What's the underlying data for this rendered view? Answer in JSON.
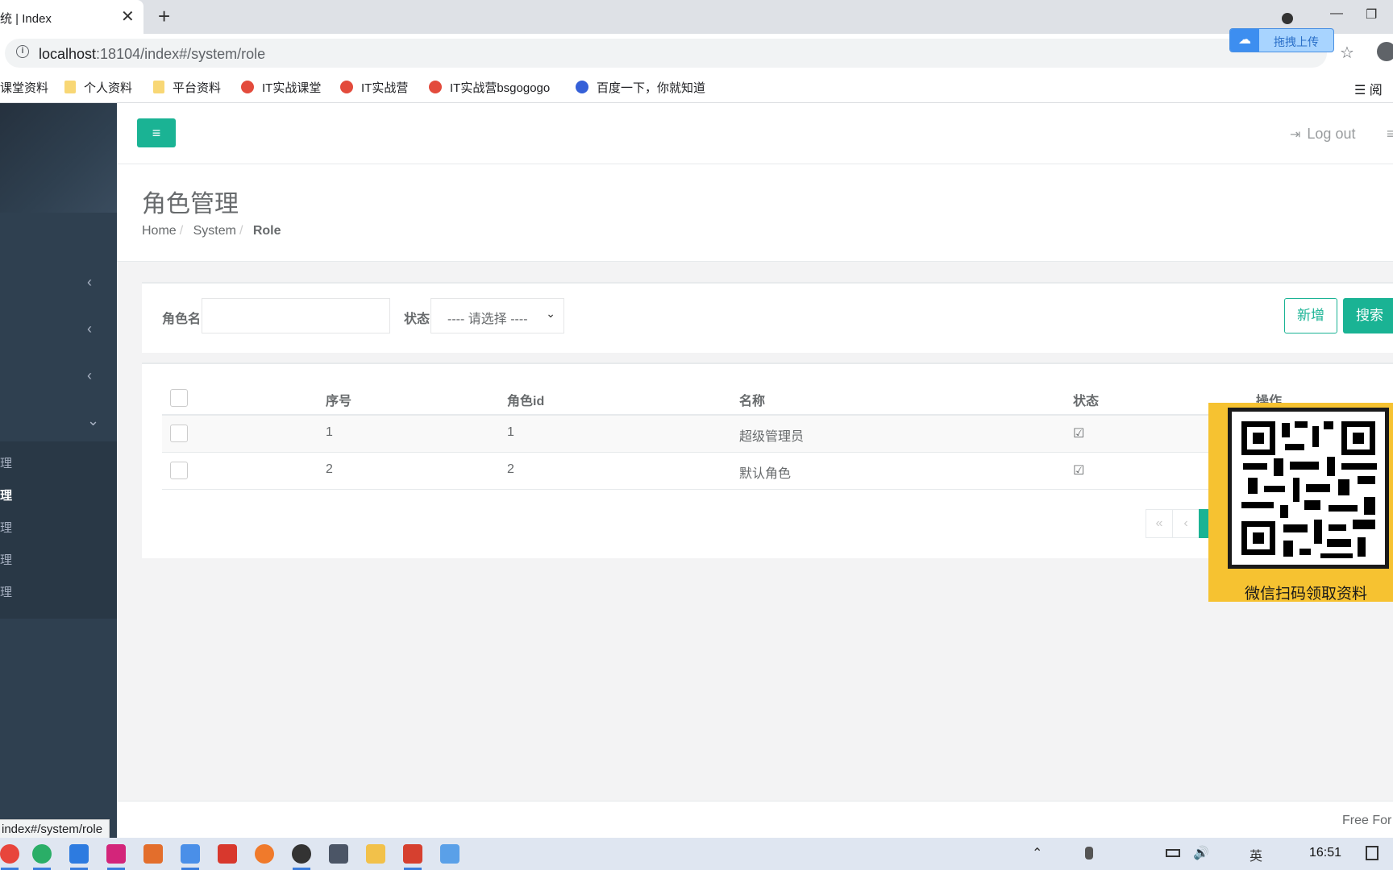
{
  "browser": {
    "tab_title": "统 | Index",
    "tab_close": "✕",
    "new_tab": "+",
    "win_min": "—",
    "win_max": "❐",
    "url_host": "localhost",
    "url_rest": ":18104/index#/system/role",
    "info_glyph": "i",
    "upload_label": "拖拽上传",
    "upload_icon": "☁",
    "star": "☆",
    "bookmarks": [
      {
        "label": "课堂资料",
        "icon": "none"
      },
      {
        "label": "个人资料",
        "icon": "folder"
      },
      {
        "label": "平台资料",
        "icon": "folder"
      },
      {
        "label": "IT实战课堂",
        "icon": "chrome"
      },
      {
        "label": "IT实战营",
        "icon": "chrome"
      },
      {
        "label": "IT实战营bsgogogo",
        "icon": "chrome"
      },
      {
        "label": "百度一下，你就知道",
        "icon": "baidu"
      }
    ],
    "reader_label": "☰ 阅",
    "status_url": "index#/system/role"
  },
  "sidebar": {
    "arrows": [
      "‹",
      "‹",
      "‹",
      "⌄"
    ],
    "sub_items": [
      "理",
      "理",
      "理",
      "理",
      "理"
    ],
    "active_index": 1
  },
  "topnav": {
    "menu_glyph": "≡",
    "logout_icon": "⇥",
    "logout_label": "Log out",
    "more_glyph": "≡"
  },
  "page": {
    "title": "角色管理",
    "breadcrumb": [
      "Home",
      "System",
      "Role"
    ]
  },
  "search": {
    "role_name_label": "角色名",
    "role_name_value": "",
    "status_label": "状态",
    "status_selected": "---- 请选择 ----",
    "add_label": "新增",
    "search_label": "搜索"
  },
  "table": {
    "columns": [
      "序号",
      "角色id",
      "名称",
      "状态",
      "操作"
    ],
    "rows": [
      {
        "index": "1",
        "role_id": "1",
        "name": "超级管理员",
        "status": "☑"
      },
      {
        "index": "2",
        "role_id": "2",
        "name": "默认角色",
        "status": "☑"
      }
    ],
    "pager": [
      "«",
      "‹"
    ]
  },
  "qr_panel": {
    "caption": "微信扫码领取资料"
  },
  "footer": {
    "text": "Free For"
  },
  "taskbar": {
    "clock": "16:51",
    "ime": "英"
  },
  "colors": {
    "accent": "#1ab394",
    "sidebar": "#2f4050",
    "qr_panel": "#f6c231"
  }
}
